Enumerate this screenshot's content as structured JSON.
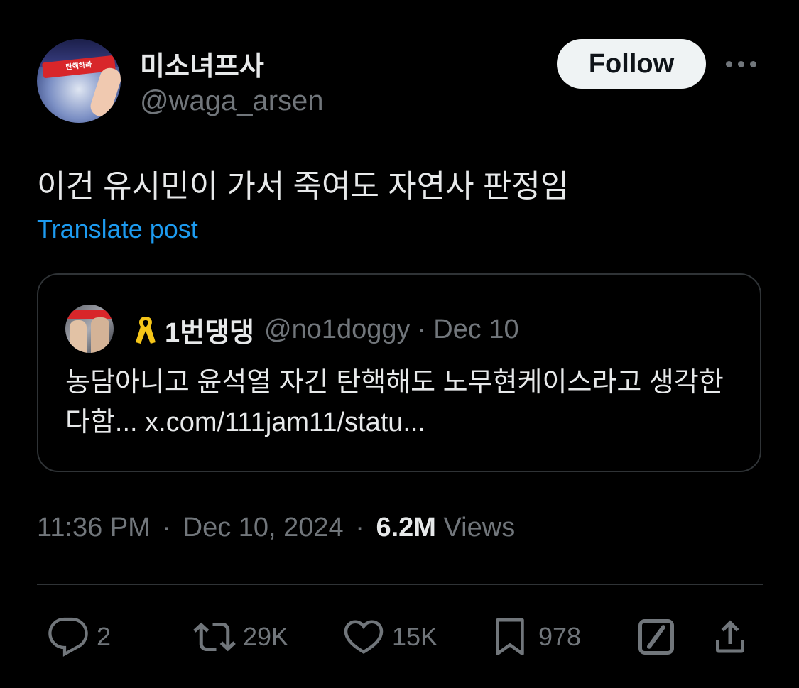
{
  "author": {
    "display_name": "미소녀프사",
    "handle": "@waga_arsen",
    "avatar_headband_text": "탄핵하라"
  },
  "follow_label": "Follow",
  "post": {
    "text": "이건 유시민이 가서 죽여도 자연사 판정임",
    "translate_label": "Translate post"
  },
  "quote": {
    "display_name": "1번댕댕",
    "handle": "@no1doggy",
    "separator": "·",
    "date": "Dec 10",
    "text": "농담아니고 윤석열 자긴 탄핵해도 노무현케이스라고 생각한다함... x.com/111jam11/statu..."
  },
  "meta": {
    "time": "11:36 PM",
    "separator": "·",
    "date": "Dec 10, 2024",
    "views_count": "6.2M",
    "views_label": "Views"
  },
  "actions": {
    "replies": "2",
    "reposts": "29K",
    "likes": "15K",
    "bookmarks": "978"
  },
  "colors": {
    "background": "#000000",
    "text": "#e7e9ea",
    "secondary": "#71767b",
    "link": "#1d9bf0",
    "border": "#2f3336",
    "ribbon": "#f5c518"
  }
}
